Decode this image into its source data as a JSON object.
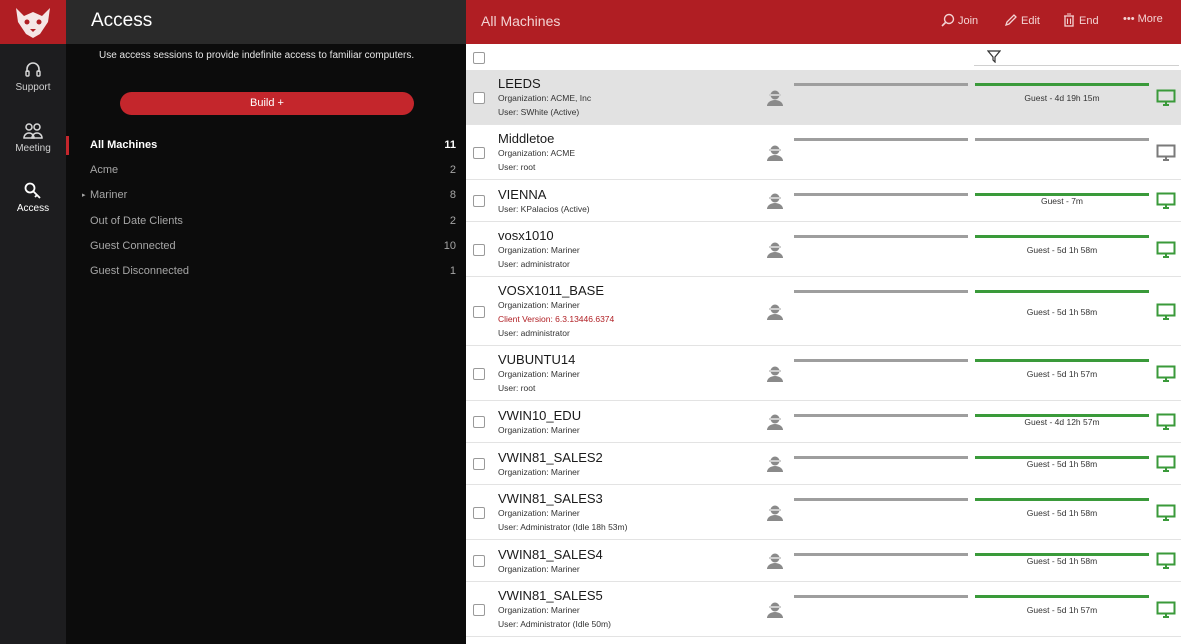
{
  "rail": {
    "items": [
      {
        "label": "Support",
        "icon": "headset-icon"
      },
      {
        "label": "Meeting",
        "icon": "people-icon"
      },
      {
        "label": "Access",
        "icon": "key-icon"
      }
    ]
  },
  "nav": {
    "title": "Access",
    "description": "Use access sessions to provide indefinite access to familiar computers.",
    "build_label": "Build +",
    "items": [
      {
        "label": "All Machines",
        "count": "11"
      },
      {
        "label": "Acme",
        "count": "2"
      },
      {
        "label": "Mariner",
        "count": "8"
      },
      {
        "label": "Out of Date Clients",
        "count": "2"
      },
      {
        "label": "Guest Connected",
        "count": "10"
      },
      {
        "label": "Guest Disconnected",
        "count": "1"
      }
    ]
  },
  "toolbar": {
    "title": "All Machines",
    "join": "Join",
    "edit": "Edit",
    "end": "End",
    "more": "More"
  },
  "colors": {
    "brand_red": "#b01e23",
    "connected_green": "#3a9a3a",
    "disconnected_gray": "#9e9e9e"
  },
  "machines": [
    {
      "name": "LEEDS",
      "details": [
        "Organization: ACME, Inc",
        "User: SWhite (Active)"
      ],
      "status": "Guest - 4d 19h 15m",
      "connected": true
    },
    {
      "name": "Middletoe",
      "details": [
        "Organization: ACME",
        "User: root"
      ],
      "status": "",
      "connected": false
    },
    {
      "name": "VIENNA",
      "details": [
        "User: KPalacios (Active)"
      ],
      "status": "Guest - 7m",
      "connected": true
    },
    {
      "name": "vosx1010",
      "details": [
        "Organization: Mariner",
        "User: administrator"
      ],
      "status": "Guest - 5d 1h 58m",
      "connected": true
    },
    {
      "name": "VOSX1011_BASE",
      "details": [
        "Organization: Mariner",
        "Client Version: 6.3.13446.6374",
        "User: administrator"
      ],
      "status": "Guest - 5d 1h 58m",
      "connected": true
    },
    {
      "name": "VUBUNTU14",
      "details": [
        "Organization: Mariner",
        "User: root"
      ],
      "status": "Guest - 5d 1h 57m",
      "connected": true
    },
    {
      "name": "VWIN10_EDU",
      "details": [
        "Organization: Mariner"
      ],
      "status": "Guest - 4d 12h 57m",
      "connected": true
    },
    {
      "name": "VWIN81_SALES2",
      "details": [
        "Organization: Mariner"
      ],
      "status": "Guest - 5d 1h 58m",
      "connected": true
    },
    {
      "name": "VWIN81_SALES3",
      "details": [
        "Organization: Mariner",
        "User: Administrator (Idle 18h 53m)"
      ],
      "status": "Guest - 5d 1h 58m",
      "connected": true
    },
    {
      "name": "VWIN81_SALES4",
      "details": [
        "Organization: Mariner"
      ],
      "status": "Guest - 5d 1h 58m",
      "connected": true
    },
    {
      "name": "VWIN81_SALES5",
      "details": [
        "Organization: Mariner",
        "User: Administrator (Idle 50m)"
      ],
      "status": "Guest - 5d 1h 57m",
      "connected": true
    }
  ]
}
